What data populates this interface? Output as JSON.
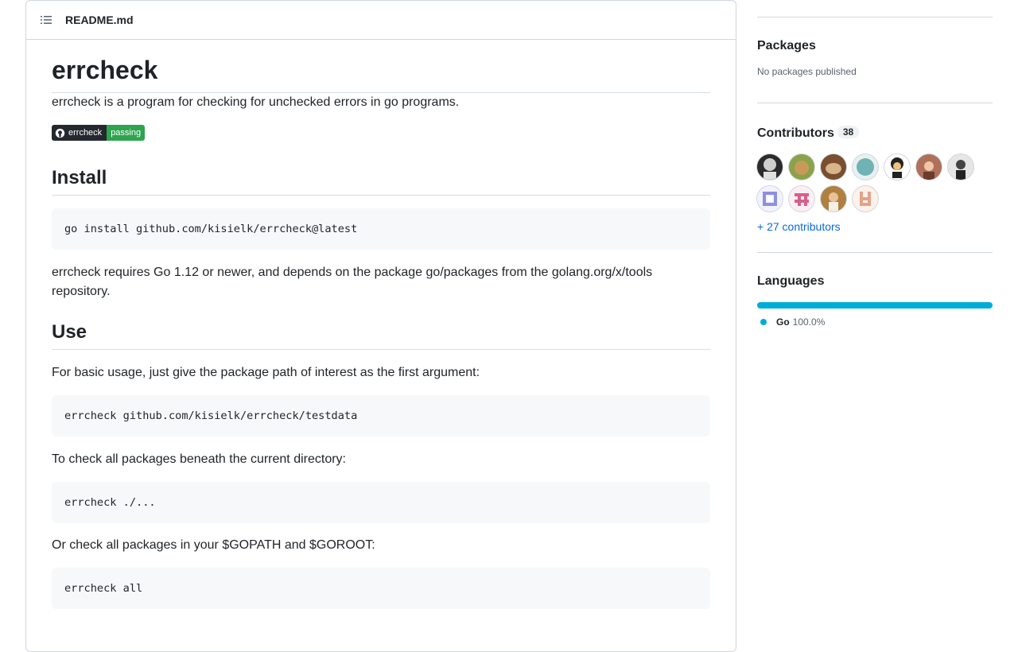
{
  "readme": {
    "filename": "README.md",
    "title": "errcheck",
    "description": "errcheck is a program for checking for unchecked errors in go programs.",
    "badge": {
      "left": "errcheck",
      "right": "passing"
    },
    "install_heading": "Install",
    "install_code": "go install github.com/kisielk/errcheck@latest",
    "requires_text": "errcheck requires Go 1.12 or newer, and depends on the package go/packages from the golang.org/x/tools repository.",
    "use_heading": "Use",
    "use_text": "For basic usage, just give the package path of interest as the first argument:",
    "use_code": "errcheck github.com/kisielk/errcheck/testdata",
    "check_all_text": "To check all packages beneath the current directory:",
    "check_all_code": "errcheck ./...",
    "gopath_text": "Or check all packages in your $GOPATH and $GOROOT:",
    "gopath_code": "errcheck all"
  },
  "sidebar": {
    "packages": {
      "title": "Packages",
      "subtitle": "No packages published"
    },
    "contributors": {
      "title": "Contributors",
      "count": "38",
      "more_link": "+ 27 contributors",
      "avatars": [
        "#2b2b2b",
        "#8aa24a",
        "#7a4e2e",
        "#6fb3b5",
        "#222222",
        "#b0705a",
        "#444444",
        "#8d8fe0",
        "#d6608a",
        "#b08040",
        "#e0a48a"
      ]
    },
    "languages": {
      "title": "Languages",
      "items": [
        {
          "name": "Go",
          "percent": "100.0%",
          "color": "#00ADD8"
        }
      ]
    }
  }
}
